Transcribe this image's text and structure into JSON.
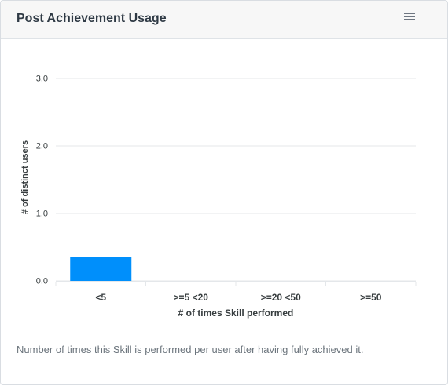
{
  "card": {
    "title": "Post Achievement Usage",
    "menu_icon": "hamburger-menu-icon",
    "footer_note": "Number of times this Skill is performed per user after having fully achieved it."
  },
  "colors": {
    "bar": "#008ffb",
    "grid": "#e4e7ea",
    "axis_text": "#373d3f"
  },
  "chart_data": {
    "type": "bar",
    "categories": [
      "<5",
      ">=5 <20",
      ">=20 <50",
      ">=50"
    ],
    "values": [
      0.35,
      0,
      0,
      0
    ],
    "xlabel": "# of times Skill performed",
    "ylabel": "# of distinct users",
    "ylim": [
      0,
      3
    ],
    "yticks": [
      "0.0",
      "1.0",
      "2.0",
      "3.0"
    ],
    "grid": true,
    "legend": "none"
  }
}
